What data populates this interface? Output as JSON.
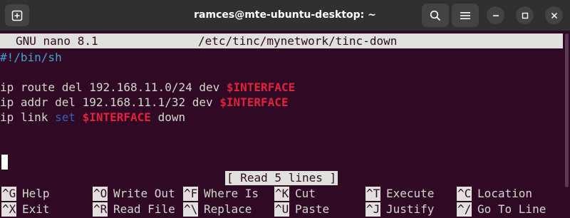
{
  "window": {
    "title": "ramces@mte-ubuntu-desktop: ~",
    "buttons": [
      "new-tab",
      "search",
      "menu",
      "minimize",
      "maximize",
      "close"
    ]
  },
  "nano": {
    "version": "GNU nano 8.1",
    "filename": "/etc/tinc/mynetwork/tinc-down",
    "lines": [
      [
        {
          "t": "#!/bin/sh",
          "c": "comment"
        }
      ],
      [],
      [
        {
          "t": "ip route del 192.168.11.0/24 dev "
        },
        {
          "t": "$INTERFACE",
          "c": "var"
        }
      ],
      [
        {
          "t": "ip addr del 192.168.11.1/32 dev "
        },
        {
          "t": "$INTERFACE",
          "c": "var"
        }
      ],
      [
        {
          "t": "ip link "
        },
        {
          "t": "set",
          "c": "kw"
        },
        {
          "t": " "
        },
        {
          "t": "$INTERFACE",
          "c": "var"
        },
        {
          "t": " down"
        }
      ]
    ],
    "status": "[ Read 5 lines ]",
    "shortcuts": [
      [
        {
          "key": "^G",
          "label": "Help"
        },
        {
          "key": "^O",
          "label": "Write Out"
        },
        {
          "key": "^F",
          "label": "Where Is"
        },
        {
          "key": "^K",
          "label": "Cut"
        },
        {
          "key": "^T",
          "label": "Execute"
        },
        {
          "key": "^C",
          "label": "Location"
        }
      ],
      [
        {
          "key": "^X",
          "label": "Exit"
        },
        {
          "key": "^R",
          "label": "Read File"
        },
        {
          "key": "^\\",
          "label": "Replace"
        },
        {
          "key": "^U",
          "label": "Paste"
        },
        {
          "key": "^J",
          "label": "Justify"
        },
        {
          "key": "^/",
          "label": "Go To Line"
        }
      ]
    ]
  },
  "colors": {
    "background": "#300a24",
    "titlebar": "#303030",
    "text": "#d3d7cf",
    "comment": "#3da4d1",
    "variable": "#e0233d",
    "keyword": "#2f62c4",
    "inverse_bg": "#e0e0dc"
  }
}
